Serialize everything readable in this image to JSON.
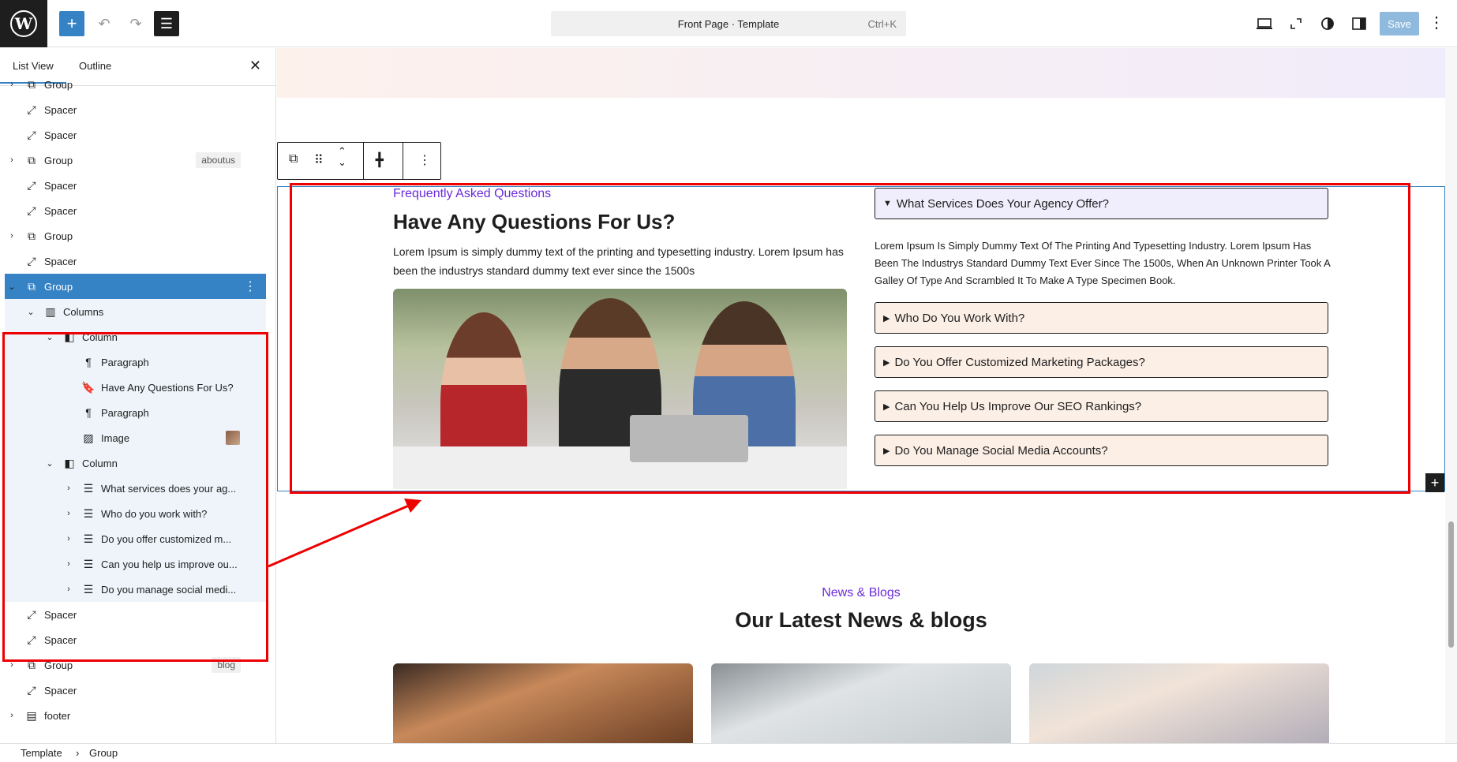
{
  "topbar": {
    "logo_letter": "W",
    "add_icon": "+",
    "undo_icon": "↶",
    "redo_icon": "↷",
    "listview_icon": "☰",
    "command_title": "Front Page · Template",
    "command_shortcut": "Ctrl+K",
    "save_label": "Save"
  },
  "sidebar": {
    "tab_list": "List View",
    "tab_outline": "Outline",
    "rows": [
      {
        "label": "Group",
        "icon": "group-icon",
        "chev": "›",
        "badge": ""
      },
      {
        "label": "Spacer",
        "icon": "spacer-icon",
        "chev": "",
        "badge": ""
      },
      {
        "label": "Spacer",
        "icon": "spacer-icon",
        "chev": "",
        "badge": ""
      },
      {
        "label": "Group",
        "icon": "group-icon",
        "chev": "›",
        "badge": "aboutus"
      },
      {
        "label": "Spacer",
        "icon": "spacer-icon",
        "chev": "",
        "badge": ""
      },
      {
        "label": "Spacer",
        "icon": "spacer-icon",
        "chev": "",
        "badge": ""
      },
      {
        "label": "Group",
        "icon": "group-icon",
        "chev": "›",
        "badge": ""
      },
      {
        "label": "Spacer",
        "icon": "spacer-icon",
        "chev": "",
        "badge": ""
      },
      {
        "label": "Group",
        "icon": "group-icon",
        "chev": "⌄",
        "badge": ""
      },
      {
        "label": "Columns",
        "icon": "columns-icon",
        "chev": "⌄",
        "badge": ""
      },
      {
        "label": "Column",
        "icon": "column-icon",
        "chev": "⌄",
        "badge": ""
      },
      {
        "label": "Paragraph",
        "icon": "paragraph-icon",
        "chev": "",
        "badge": ""
      },
      {
        "label": "Have Any Questions For Us?",
        "icon": "heading-icon",
        "chev": "",
        "badge": ""
      },
      {
        "label": "Paragraph",
        "icon": "paragraph-icon",
        "chev": "",
        "badge": ""
      },
      {
        "label": "Image",
        "icon": "image-icon",
        "chev": "",
        "badge": ""
      },
      {
        "label": "Column",
        "icon": "column-icon",
        "chev": "⌄",
        "badge": ""
      },
      {
        "label": "What services does your ag...",
        "icon": "details-icon",
        "chev": "›",
        "badge": ""
      },
      {
        "label": "Who do you work with?",
        "icon": "details-icon",
        "chev": "›",
        "badge": ""
      },
      {
        "label": "Do you offer customized m...",
        "icon": "details-icon",
        "chev": "›",
        "badge": ""
      },
      {
        "label": "Can you help us improve ou...",
        "icon": "details-icon",
        "chev": "›",
        "badge": ""
      },
      {
        "label": "Do you manage social medi...",
        "icon": "details-icon",
        "chev": "›",
        "badge": ""
      },
      {
        "label": "Spacer",
        "icon": "spacer-icon",
        "chev": "",
        "badge": ""
      },
      {
        "label": "Spacer",
        "icon": "spacer-icon",
        "chev": "",
        "badge": ""
      },
      {
        "label": "Group",
        "icon": "group-icon",
        "chev": "›",
        "badge": "blog"
      },
      {
        "label": "Spacer",
        "icon": "spacer-icon",
        "chev": "",
        "badge": ""
      },
      {
        "label": "footer",
        "icon": "template-part-icon",
        "chev": "›",
        "badge": ""
      }
    ]
  },
  "faq": {
    "eyebrow": "Frequently Asked Questions",
    "title": "Have Any Questions For Us?",
    "text": "Lorem Ipsum is simply dummy text of the printing and typesetting industry. Lorem Ipsum has been the industrys standard dummy text ever since the 1500s",
    "items": [
      "What Services Does Your Agency Offer?",
      "Who Do You Work With?",
      "Do You Offer Customized Marketing Packages?",
      "Can You Help Us Improve Our SEO Rankings?",
      "Do You Manage Social Media Accounts?"
    ],
    "open_body": "Lorem Ipsum Is Simply Dummy Text Of The Printing And Typesetting Industry. Lorem Ipsum Has Been The Industrys Standard Dummy Text Ever Since The 1500s, When An Unknown Printer Took A Galley Of Type And Scrambled It To Make A Type Specimen Book."
  },
  "news": {
    "eyebrow": "News & Blogs",
    "title": "Our Latest News & blogs"
  },
  "breadcrumb": {
    "root": "Template",
    "leaf": "Group"
  },
  "colors": {
    "accent": "#3582c4",
    "purple": "#6a2bd9",
    "annotation": "#e00000"
  }
}
